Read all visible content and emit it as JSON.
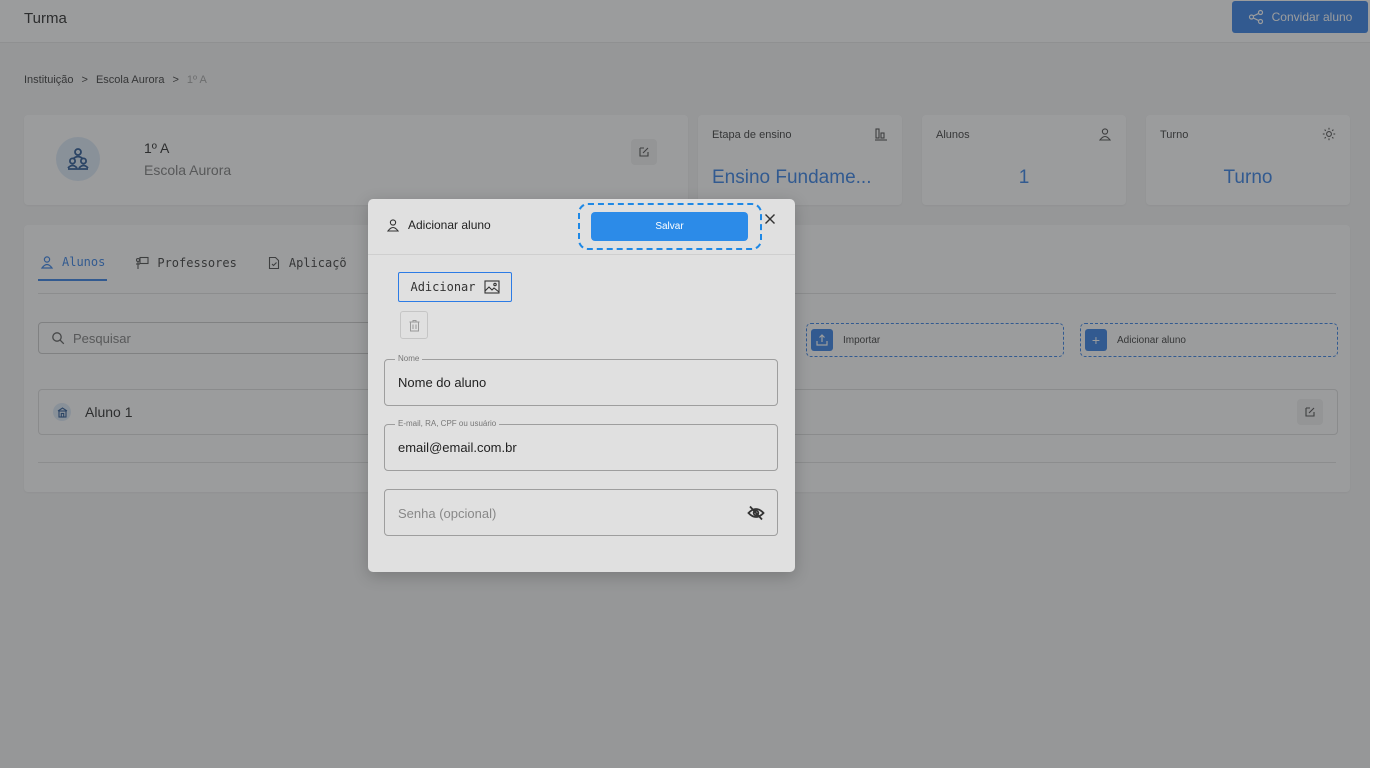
{
  "header": {
    "title": "Turma",
    "invite_label": "Convidar aluno"
  },
  "breadcrumb": {
    "items": [
      "Instituição",
      "Escola Aurora",
      "1º A"
    ],
    "separator": ">"
  },
  "class_card": {
    "name": "1º A",
    "school": "Escola Aurora"
  },
  "stats": [
    {
      "label": "Etapa de ensino",
      "value": "Ensino Fundame...",
      "icon": "stage-icon"
    },
    {
      "label": "Alunos",
      "value": "1",
      "icon": "person-icon"
    },
    {
      "label": "Turno",
      "value": "Turno",
      "icon": "sun-icon"
    }
  ],
  "tabs": [
    {
      "label": "Alunos",
      "icon": "person-icon",
      "active": true
    },
    {
      "label": "Professores",
      "icon": "teacher-icon",
      "active": false
    },
    {
      "label": "Aplicaçõ",
      "icon": "document-icon",
      "active": false
    }
  ],
  "search": {
    "placeholder": "Pesquisar"
  },
  "actions": {
    "import_label": "Importar",
    "add_label": "Adicionar aluno"
  },
  "students": [
    {
      "name": "Aluno 1"
    }
  ],
  "modal": {
    "title": "Adicionar aluno",
    "save_label": "Salvar",
    "add_photo_label": "Adicionar",
    "name_field": {
      "legend": "Nome",
      "value": "Nome do aluno"
    },
    "login_field": {
      "legend": "E-mail, RA, CPF ou usuário",
      "value": "email@email.com.br"
    },
    "password_field": {
      "placeholder": "Senha (opcional)"
    }
  },
  "colors": {
    "accent": "#2c7be5",
    "overlay": "rgba(55,57,60,0.5)"
  }
}
